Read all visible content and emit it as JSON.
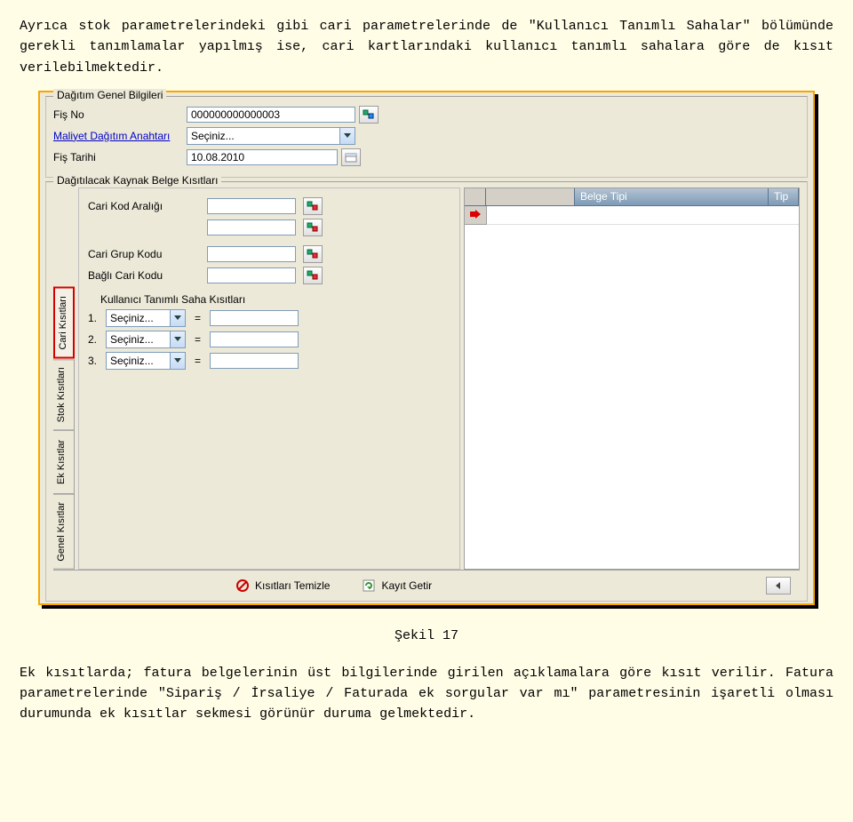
{
  "para_top": "Ayrıca stok parametrelerindeki gibi cari parametrelerinde de \"Kullanıcı Tanımlı Sahalar\" bölümünde gerekli tanımlamalar yapılmış ise, cari kartlarındaki kullanıcı tanımlı sahalara göre de kısıt verilebilmektedir.",
  "header": {
    "legend": "Dağıtım Genel Bilgileri",
    "fis_no_label": "Fiş No",
    "fis_no_value": "000000000000003",
    "anahtar_label": "Maliyet Dağıtım Anahtarı",
    "anahtar_value": "Seçiniz...",
    "tarih_label": "Fiş Tarihi",
    "tarih_value": "10.08.2010"
  },
  "lower_legend": "Dağıtılacak Kaynak Belge Kısıtları",
  "tabs": {
    "genel": "Genel Kısıtlar",
    "ek": "Ek Kısıtlar",
    "stok": "Stok Kısıtları",
    "cari": "Cari Kısıtları"
  },
  "cari_panel": {
    "kod_araligi": "Cari Kod Aralığı",
    "grup_kodu": "Cari Grup Kodu",
    "bagli_kodu": "Bağlı Cari Kodu",
    "saha_baslik": "Kullanıcı Tanımlı Saha Kısıtları",
    "n1": "1.",
    "n2": "2.",
    "n3": "3.",
    "sec": "Seçiniz...",
    "eq": "="
  },
  "grid": {
    "col1": "Belge Tipi",
    "col2": "Tip"
  },
  "footer": {
    "temizle": "Kısıtları Temizle",
    "getir": "Kayıt Getir"
  },
  "caption": "Şekil 17",
  "para_bottom": "Ek kısıtlarda; fatura belgelerinin üst bilgilerinde girilen açıklamalara göre kısıt verilir. Fatura parametrelerinde \"Sipariş / İrsaliye / Faturada ek sorgular var mı\" parametresinin işaretli olması durumunda ek kısıtlar sekmesi görünür duruma gelmektedir."
}
